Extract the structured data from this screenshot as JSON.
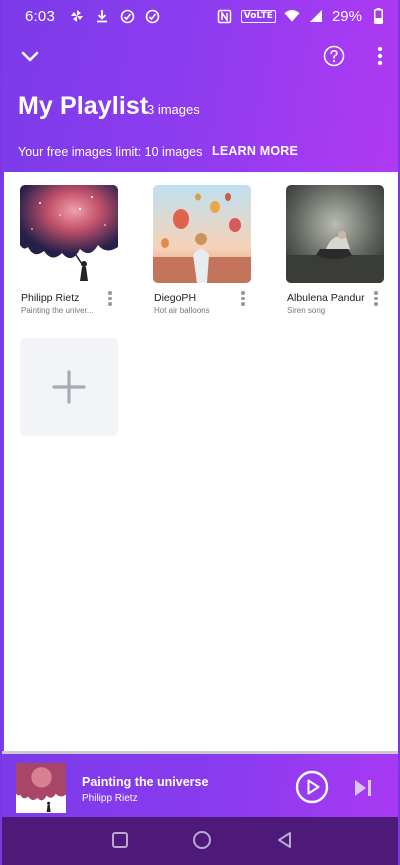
{
  "status_bar": {
    "time": "6:03",
    "volte": "VoLTE",
    "battery": "29%"
  },
  "header": {
    "title": "My Playlist",
    "count": "3 images",
    "limit_text": "Your free images limit:  10 images",
    "learn_more": "LEARN MORE"
  },
  "playlist": {
    "items": [
      {
        "artist": "Philipp Rietz",
        "subtitle": "Painting the univer...",
        "image": "painting-the-universe"
      },
      {
        "artist": "DiegoPH",
        "subtitle": "Hot air balloons",
        "image": "hot-air-balloons"
      },
      {
        "artist": "Albulena Panduri",
        "subtitle": "Siren song",
        "image": "siren-song"
      }
    ]
  },
  "now_playing": {
    "title": "Painting the universe",
    "artist": "Philipp Rietz"
  },
  "icons": {
    "collapse": "chevron-down-icon",
    "help": "help-circle-icon",
    "more": "more-vertical-icon",
    "add": "plus-icon",
    "play": "play-circle-icon",
    "skip": "skip-next-icon"
  },
  "colors": {
    "header_start": "#7b3be9",
    "header_end": "#b13af3",
    "nav_bar": "#4d1a7a",
    "add_tile": "#f2f4f7"
  }
}
